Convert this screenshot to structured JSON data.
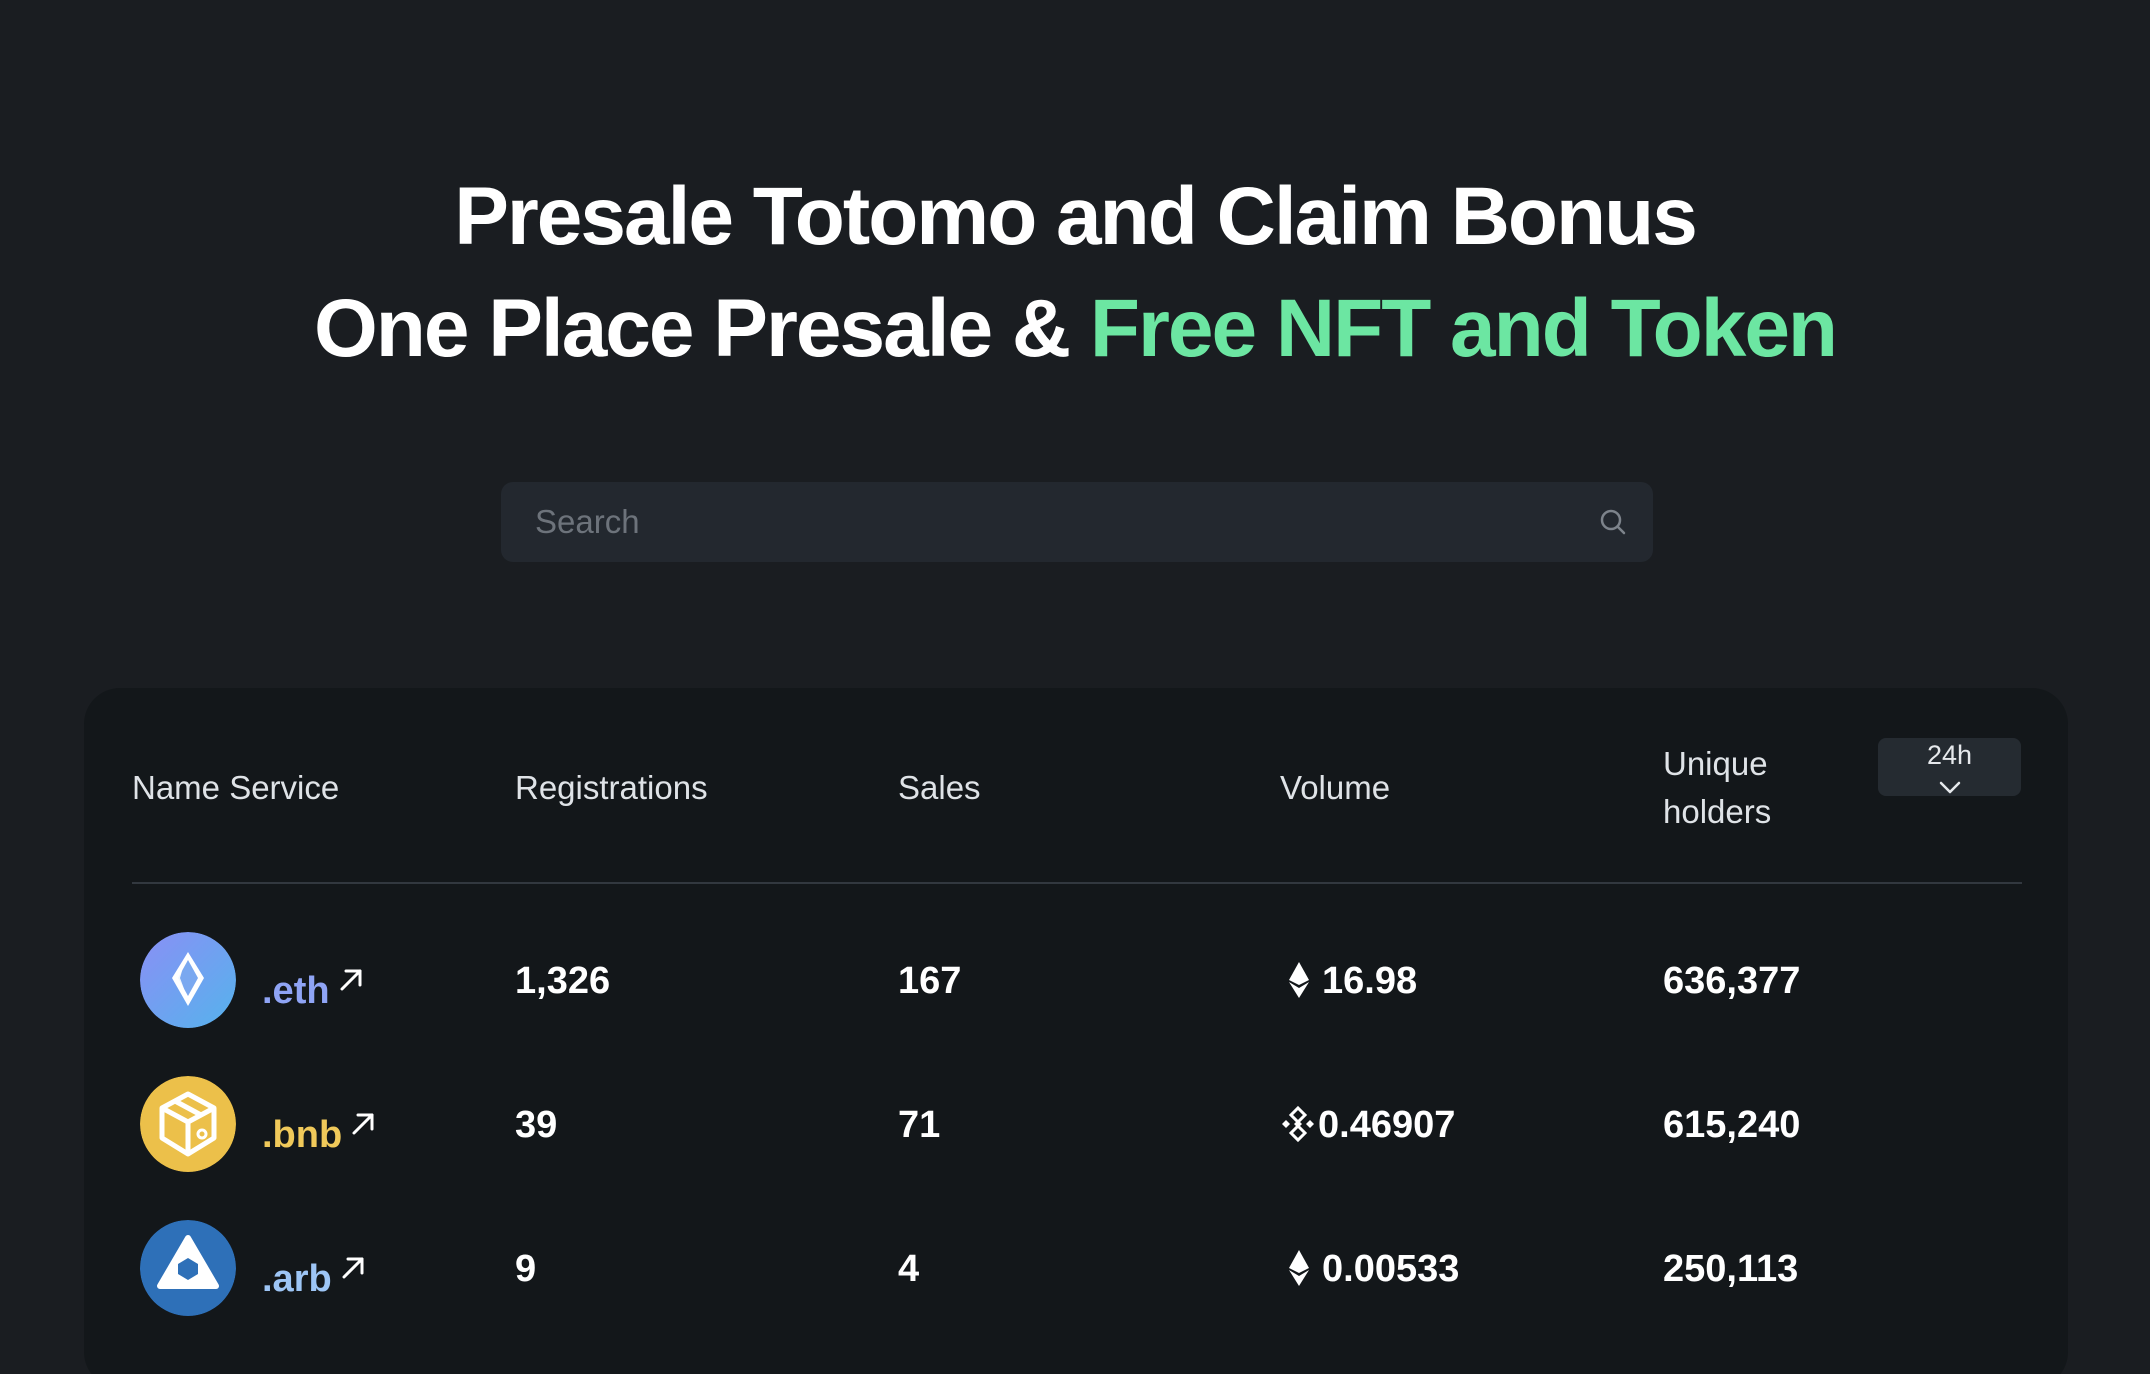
{
  "hero": {
    "line1": "Presale Totomo and Claim Bonus",
    "line2_prefix": "One Place Presale & ",
    "line2_accent": "Free NFT and Token"
  },
  "search": {
    "placeholder": "Search",
    "value": ""
  },
  "table": {
    "columns": {
      "name_service": "Name Service",
      "registrations": "Registrations",
      "sales": "Sales",
      "volume": "Volume",
      "holders_line1": "Unique",
      "holders_line2": "holders"
    },
    "period": {
      "selected": "24h",
      "icon": "chevron-down-icon"
    },
    "rows": [
      {
        "name": ".eth",
        "name_color": "#8fa4f5",
        "logo": "ens-logo",
        "registrations": "1,326",
        "sales": "167",
        "volume": "16.98",
        "volume_icon": "ethereum-icon",
        "holders": "636,377"
      },
      {
        "name": ".bnb",
        "name_color": "#f0c95a",
        "logo": "spaceid-logo",
        "registrations": "39",
        "sales": "71",
        "volume": "0.46907",
        "volume_icon": "bnb-icon",
        "holders": "615,240"
      },
      {
        "name": ".arb",
        "name_color": "#9dc5f5",
        "logo": "arbitrum-logo",
        "registrations": "9",
        "sales": "4",
        "volume": "0.00533",
        "volume_icon": "ethereum-icon",
        "holders": "250,113"
      }
    ]
  },
  "colors": {
    "background": "#1a1d21",
    "card": "#13171a",
    "accent": "#6ce6a2"
  }
}
